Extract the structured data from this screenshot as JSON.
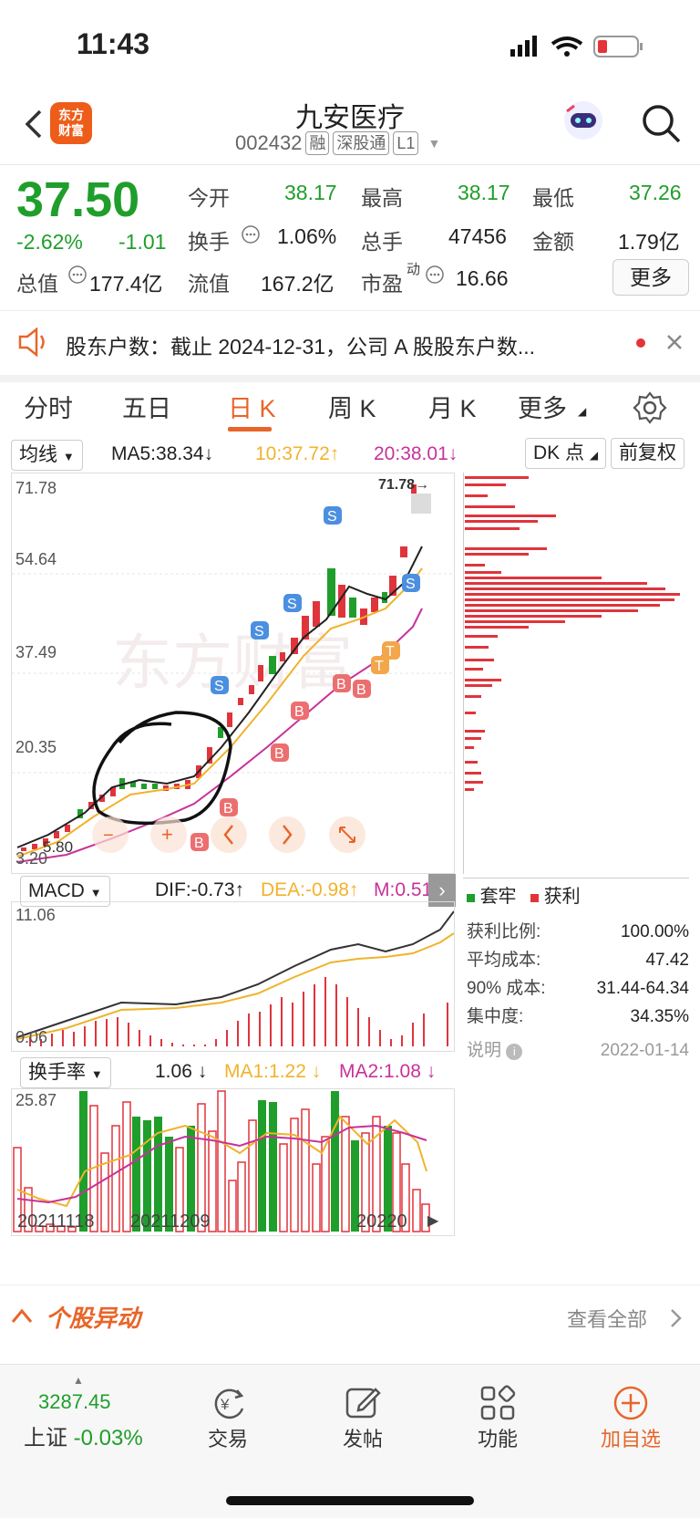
{
  "status": {
    "time": "11:43"
  },
  "header": {
    "logo_line1": "东方",
    "logo_line2": "财富",
    "title": "九安医疗",
    "code": "002432",
    "tags": [
      "融",
      "深股通",
      "L1"
    ]
  },
  "quote": {
    "price": "37.50",
    "change_pct": "-2.62%",
    "change": "-1.01",
    "fields": [
      {
        "label": "今开",
        "value": "38.17",
        "color": "#1f9e2b"
      },
      {
        "label": "最高",
        "value": "38.17",
        "color": "#1f9e2b"
      },
      {
        "label": "最低",
        "value": "37.26",
        "color": "#1f9e2b"
      },
      {
        "label": "换手",
        "value": "1.06%",
        "color": "#222222"
      },
      {
        "label": "总手",
        "value": "47456",
        "color": "#222222"
      },
      {
        "label": "金额",
        "value": "1.79亿",
        "color": "#222222"
      },
      {
        "label": "总值",
        "value": "177.4亿",
        "color": "#222222"
      },
      {
        "label": "流值",
        "value": "167.2亿",
        "color": "#222222"
      },
      {
        "label": "市盈",
        "value": "16.66",
        "color": "#222222"
      }
    ],
    "pe_super": "动",
    "more_label": "更多"
  },
  "notice": {
    "text": "股东户数：截止 2024-12-31，公司 A 股股东户数..."
  },
  "tabs": {
    "items": [
      "分时",
      "五日",
      "日 K",
      "周 K",
      "月 K",
      "更多"
    ],
    "active": "日 K"
  },
  "kline": {
    "ma_select": "均线",
    "ma5": "MA5:38.34",
    "ma10": "10:37.72",
    "ma20": "20:38.01",
    "dk_label": "DK 点",
    "adjust_label": "前复权",
    "y_ticks": [
      "71.78",
      "54.64",
      "37.49",
      "20.35",
      "3.20"
    ],
    "peak_label": "71.78→",
    "low_label": "5.80",
    "colors": {
      "up": "#e0343c",
      "down": "#1f9e2b",
      "ma5": "#222222",
      "ma10": "#f0b32c",
      "ma20": "#c7329a"
    }
  },
  "macd": {
    "select": "MACD",
    "dif": "DIF:-0.73",
    "dea": "DEA:-0.98",
    "m": "M:0.51",
    "top": "11.06",
    "bottom": "0.06"
  },
  "turnover": {
    "select": "换手率",
    "value": "1.06",
    "ma1": "MA1:1.22",
    "ma2": "MA2:1.08",
    "top": "25.87",
    "dates": [
      "20211118",
      "20211209",
      "20220"
    ]
  },
  "distribution": {
    "legend_trapped": "套牢",
    "legend_profit": "获利",
    "rows": [
      {
        "label": "获利比例:",
        "value": "100.00%"
      },
      {
        "label": "平均成本:",
        "value": "47.42"
      },
      {
        "label": "90% 成本:",
        "value": "31.44-64.34"
      },
      {
        "label": "集中度:",
        "value": "34.35%"
      }
    ],
    "note_label": "说明",
    "date": "2022-01-14"
  },
  "movement": {
    "title": "个股异动",
    "link": "查看全部"
  },
  "footer": {
    "index_value": "3287.45",
    "index_name": "上证",
    "index_change": "-0.03%",
    "items": [
      "交易",
      "发帖",
      "功能",
      "加自选"
    ]
  }
}
